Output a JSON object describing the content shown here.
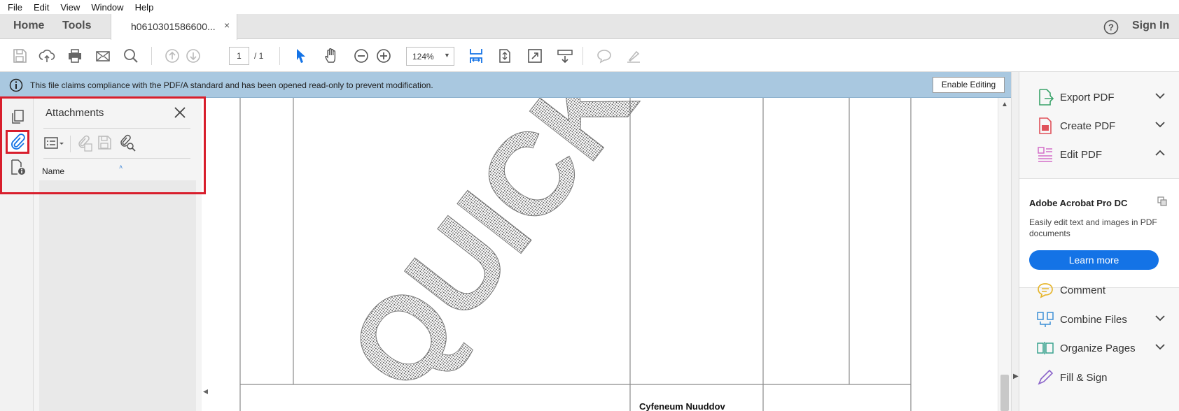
{
  "menu": [
    "File",
    "Edit",
    "View",
    "Window",
    "Help"
  ],
  "nav": {
    "home": "Home",
    "tools": "Tools",
    "sign_in": "Sign In"
  },
  "document_tab": {
    "title": "h0610301586600...",
    "close": "×"
  },
  "toolbar": {
    "page_current": "1",
    "page_total": "/ 1",
    "zoom": "124%",
    "icons": [
      "save-icon",
      "upload-icon",
      "print-icon",
      "email-icon",
      "search-icon",
      "prev-page-icon",
      "next-page-icon",
      "select-pointer-icon",
      "hand-icon",
      "zoom-out-icon",
      "zoom-in-icon",
      "fit-page-icon",
      "scroll-mode-icon",
      "full-screen-icon",
      "read-mode-icon",
      "comment-icon",
      "highlight-icon"
    ]
  },
  "notice": {
    "text": "This file claims compliance with the PDF/A standard and has been opened read-only to prevent modification.",
    "button": "Enable Editing"
  },
  "attachments_panel": {
    "title": "Attachments",
    "column_name": "Name",
    "sort_indicator": "˄"
  },
  "document": {
    "watermark": "QUICK QUO",
    "cell_text": "Cyfeneum Nuuddov"
  },
  "right_pane": {
    "tools_top": [
      {
        "label": "Export PDF",
        "icon": "export-pdf-icon",
        "chevron": "down"
      },
      {
        "label": "Create PDF",
        "icon": "create-pdf-icon",
        "chevron": "down"
      },
      {
        "label": "Edit PDF",
        "icon": "edit-pdf-icon",
        "chevron": "up"
      }
    ],
    "promo": {
      "title": "Adobe Acrobat Pro DC",
      "description": "Easily edit text and images in PDF documents",
      "button": "Learn more"
    },
    "tools_bottom": [
      {
        "label": "Comment",
        "icon": "comment-tool-icon",
        "chevron": ""
      },
      {
        "label": "Combine Files",
        "icon": "combine-files-icon",
        "chevron": "down"
      },
      {
        "label": "Organize Pages",
        "icon": "organize-pages-icon",
        "chevron": "down"
      },
      {
        "label": "Fill & Sign",
        "icon": "fill-sign-icon",
        "chevron": ""
      }
    ]
  },
  "colors": {
    "notice_bg": "#a9c8e0",
    "highlight_red": "#d81e2c",
    "accent_blue": "#1473e6"
  }
}
